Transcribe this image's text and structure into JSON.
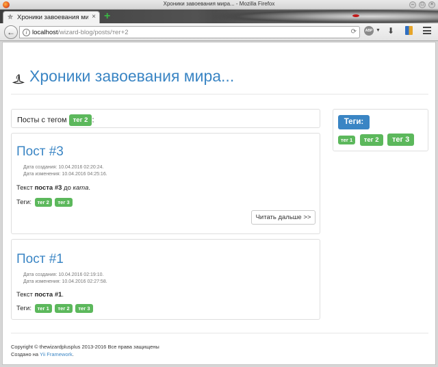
{
  "window": {
    "title": "Хроники завоевания мира... - Mozilla Firefox"
  },
  "tab": {
    "title": "Хроники завоевания ми..."
  },
  "url": {
    "host": "localhost",
    "path": "/wizard-blog/posts/тег+2"
  },
  "site": {
    "title": "Хроники завоевания мира..."
  },
  "tag_filter": {
    "prefix": "Посты с тегом",
    "tag": "тег 2",
    "suffix": ":"
  },
  "posts": [
    {
      "title": "Пост #3",
      "created": "Дата создания: 10.04.2016 02:20:24.",
      "modified": "Дата изменения: 10.04.2016 04:25:16.",
      "text_prefix": "Текст ",
      "text_bold": "поста #3",
      "text_middle": " до ",
      "text_italic": "ката",
      "text_suffix": ".",
      "tags_label": "Теги:",
      "tags": [
        "тег 2",
        "тег 3"
      ],
      "read_more": "Читать дальше >>"
    },
    {
      "title": "Пост #1",
      "created": "Дата создания: 10.04.2016 02:19:10.",
      "modified": "Дата изменения: 10.04.2016 02:27:58.",
      "text_prefix": "Текст ",
      "text_bold": "поста #1",
      "text_suffix": ".",
      "tags_label": "Теги:",
      "tags": [
        "тег 1",
        "тег 2",
        "тег 3"
      ]
    }
  ],
  "sidebar": {
    "heading": "Теги:",
    "tags": [
      "тег 1",
      "тег 2",
      "тег 3"
    ]
  },
  "footer": {
    "copyright": "Copyright © thewizardplusplus 2013-2016 Все права защищены",
    "made_prefix": "Создано на ",
    "made_link": "Yii Framework",
    "made_suffix": "."
  },
  "colors": {
    "accent": "#3a85c4",
    "tag_badge": "#5cb85c"
  },
  "icons": {
    "logo": "wizard-hat-icon",
    "info": "info-icon",
    "reload": "reload-icon",
    "adblock": "adblock-icon",
    "download": "download-icon",
    "bookmarks": "bookmarks-icon",
    "menu": "hamburger-menu-icon"
  }
}
